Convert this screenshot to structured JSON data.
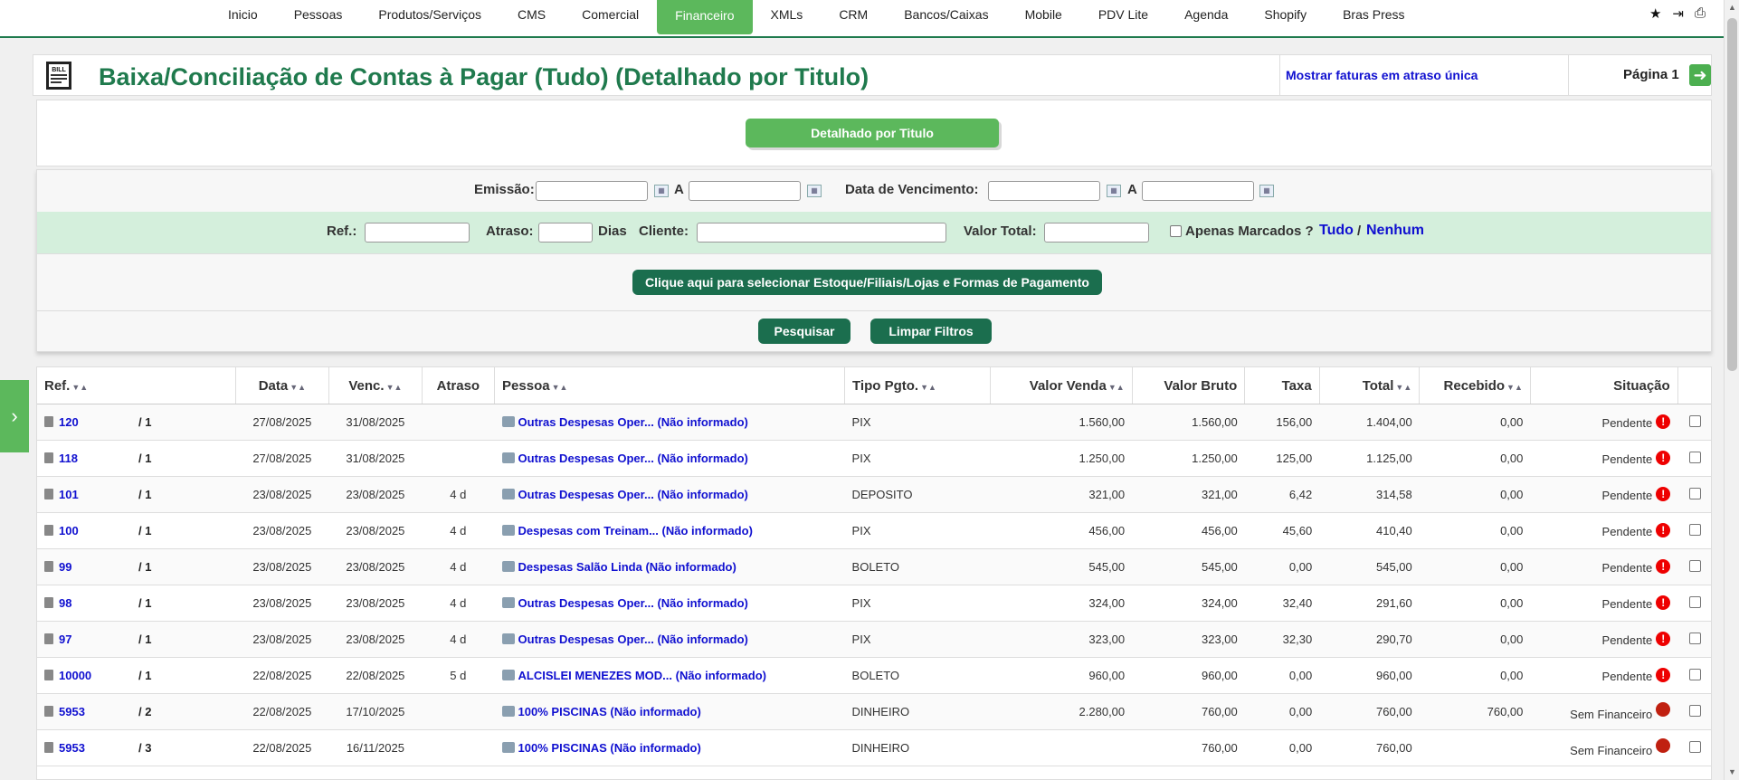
{
  "nav": {
    "items": [
      "Inicio",
      "Pessoas",
      "Produtos/Serviços",
      "CMS",
      "Comercial",
      "Financeiro",
      "XMLs",
      "CRM",
      "Bancos/Caixas",
      "Mobile",
      "PDV Lite",
      "Agenda",
      "Shopify",
      "Bras Press"
    ],
    "active": "Financeiro",
    "right_icons": [
      "star-icon",
      "logout-icon",
      "print-icon"
    ]
  },
  "title": "Baixa/Conciliação de Contas à Pagar (Tudo) (Detalhado por Titulo)",
  "title_icon_text": "BILL",
  "overdue_link": "Mostrar faturas em atraso única",
  "page_label": "Página 1",
  "mode_button": "Detalhado por Titulo",
  "filters": {
    "emissao_label": "Emissão:",
    "a_label": "A",
    "vencimento_label": "Data de Vencimento:",
    "ref_label": "Ref.:",
    "atraso_label": "Atraso:",
    "dias_label": "Dias",
    "cliente_label": "Cliente:",
    "valor_total_label": "Valor Total:",
    "apenas_marcados_label": "Apenas Marcados ?",
    "tudo_link": "Tudo",
    "slash": "/",
    "nenhum_link": "Nenhum",
    "select_button": "Clique aqui para selecionar Estoque/Filiais/Lojas e Formas de Pagamento",
    "pesquisar_button": "Pesquisar",
    "limpar_button": "Limpar Filtros"
  },
  "table": {
    "headers": {
      "ref": "Ref.",
      "data": "Data",
      "venc": "Venc.",
      "atraso": "Atraso",
      "pessoa": "Pessoa",
      "tipo": "Tipo Pgto.",
      "valor_venda": "Valor Venda",
      "valor_bruto": "Valor Bruto",
      "taxa": "Taxa",
      "total": "Total",
      "recebido": "Recebido",
      "situacao": "Situação"
    },
    "rows": [
      {
        "ref": "120",
        "parcela": "/ 1",
        "data": "27/08/2025",
        "venc": "31/08/2025",
        "atraso": "",
        "pessoa": "Outras Despesas Oper... (Não informado)",
        "tipo": "PIX",
        "valor_venda": "1.560,00",
        "valor_bruto": "1.560,00",
        "taxa": "156,00",
        "total": "1.404,00",
        "recebido": "0,00",
        "situacao": "Pendente",
        "status": "pendente"
      },
      {
        "ref": "118",
        "parcela": "/ 1",
        "data": "27/08/2025",
        "venc": "31/08/2025",
        "atraso": "",
        "pessoa": "Outras Despesas Oper... (Não informado)",
        "tipo": "PIX",
        "valor_venda": "1.250,00",
        "valor_bruto": "1.250,00",
        "taxa": "125,00",
        "total": "1.125,00",
        "recebido": "0,00",
        "situacao": "Pendente",
        "status": "pendente"
      },
      {
        "ref": "101",
        "parcela": "/ 1",
        "data": "23/08/2025",
        "venc": "23/08/2025",
        "atraso": "4 d",
        "pessoa": "Outras Despesas Oper... (Não informado)",
        "tipo": "DEPOSITO",
        "valor_venda": "321,00",
        "valor_bruto": "321,00",
        "taxa": "6,42",
        "total": "314,58",
        "recebido": "0,00",
        "situacao": "Pendente",
        "status": "pendente"
      },
      {
        "ref": "100",
        "parcela": "/ 1",
        "data": "23/08/2025",
        "venc": "23/08/2025",
        "atraso": "4 d",
        "pessoa": "Despesas com Treinam... (Não informado)",
        "tipo": "PIX",
        "valor_venda": "456,00",
        "valor_bruto": "456,00",
        "taxa": "45,60",
        "total": "410,40",
        "recebido": "0,00",
        "situacao": "Pendente",
        "status": "pendente"
      },
      {
        "ref": "99",
        "parcela": "/ 1",
        "data": "23/08/2025",
        "venc": "23/08/2025",
        "atraso": "4 d",
        "pessoa": "Despesas Salão Linda (Não informado)",
        "tipo": "BOLETO",
        "valor_venda": "545,00",
        "valor_bruto": "545,00",
        "taxa": "0,00",
        "total": "545,00",
        "recebido": "0,00",
        "situacao": "Pendente",
        "status": "pendente"
      },
      {
        "ref": "98",
        "parcela": "/ 1",
        "data": "23/08/2025",
        "venc": "23/08/2025",
        "atraso": "4 d",
        "pessoa": "Outras Despesas Oper... (Não informado)",
        "tipo": "PIX",
        "valor_venda": "324,00",
        "valor_bruto": "324,00",
        "taxa": "32,40",
        "total": "291,60",
        "recebido": "0,00",
        "situacao": "Pendente",
        "status": "pendente"
      },
      {
        "ref": "97",
        "parcela": "/ 1",
        "data": "23/08/2025",
        "venc": "23/08/2025",
        "atraso": "4 d",
        "pessoa": "Outras Despesas Oper... (Não informado)",
        "tipo": "PIX",
        "valor_venda": "323,00",
        "valor_bruto": "323,00",
        "taxa": "32,30",
        "total": "290,70",
        "recebido": "0,00",
        "situacao": "Pendente",
        "status": "pendente"
      },
      {
        "ref": "10000",
        "parcela": "/ 1",
        "data": "22/08/2025",
        "venc": "22/08/2025",
        "atraso": "5 d",
        "pessoa": "ALCISLEI MENEZES MOD... (Não informado)",
        "tipo": "BOLETO",
        "valor_venda": "960,00",
        "valor_bruto": "960,00",
        "taxa": "0,00",
        "total": "960,00",
        "recebido": "0,00",
        "situacao": "Pendente",
        "status": "pendente"
      },
      {
        "ref": "5953",
        "parcela": "/ 2",
        "data": "22/08/2025",
        "venc": "17/10/2025",
        "atraso": "",
        "pessoa": "100% PISCINAS (Não informado)",
        "tipo": "DINHEIRO",
        "valor_venda": "2.280,00",
        "valor_bruto": "760,00",
        "taxa": "0,00",
        "total": "760,00",
        "recebido": "760,00",
        "situacao": "Sem Financeiro",
        "status": "semfin"
      },
      {
        "ref": "5953",
        "parcela": "/ 3",
        "data": "22/08/2025",
        "venc": "16/11/2025",
        "atraso": "",
        "pessoa": "100% PISCINAS (Não informado)",
        "tipo": "DINHEIRO",
        "valor_venda": "",
        "valor_bruto": "760,00",
        "taxa": "0,00",
        "total": "760,00",
        "recebido": "",
        "situacao": "Sem Financeiro",
        "status": "semfin"
      }
    ]
  },
  "colors": {
    "brand_green": "#1f7a4d",
    "button_green": "#5cb85c",
    "dark_button": "#1b6e4e",
    "link_blue": "#1010d0",
    "filter_row_bg": "#d4efdc",
    "status_red": "#e00000"
  }
}
